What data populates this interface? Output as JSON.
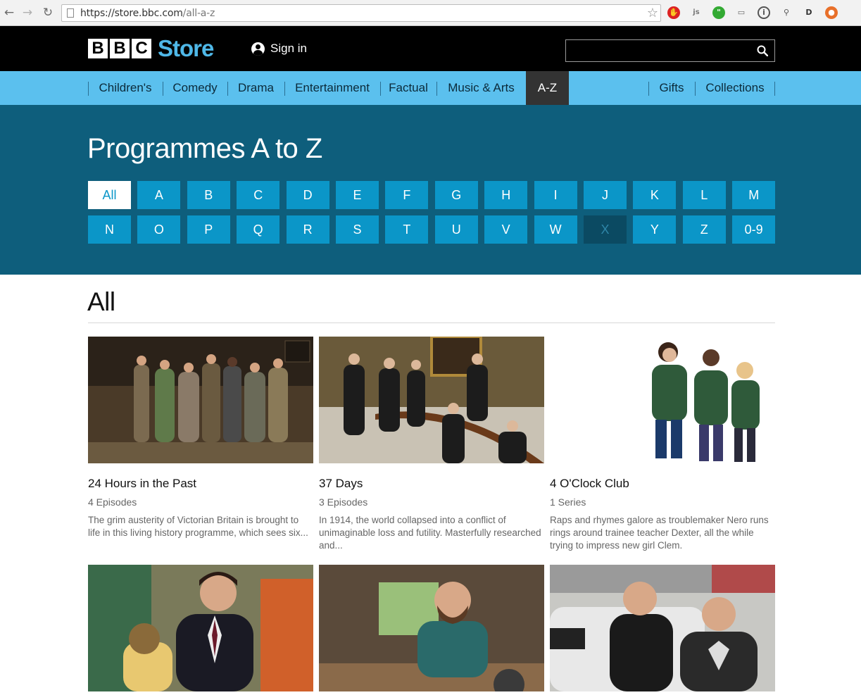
{
  "browser": {
    "url_host": "https://store.bbc.com",
    "url_path": "/all-a-z"
  },
  "header": {
    "logo_letters": [
      "B",
      "B",
      "C"
    ],
    "logo_store": "Store",
    "sign_in": "Sign in",
    "search_placeholder": ""
  },
  "categories": [
    {
      "label": "Children's",
      "active": false
    },
    {
      "label": "Comedy",
      "active": false
    },
    {
      "label": "Drama",
      "active": false
    },
    {
      "label": "Entertainment",
      "active": false
    },
    {
      "label": "Factual",
      "active": false
    },
    {
      "label": "Music & Arts",
      "active": false
    },
    {
      "label": "A-Z",
      "active": true
    }
  ],
  "right_links": [
    "Gifts",
    "Collections"
  ],
  "az": {
    "title": "Programmes A to Z",
    "row1": [
      "All",
      "A",
      "B",
      "C",
      "D",
      "E",
      "F",
      "G",
      "H",
      "I",
      "J",
      "K",
      "L",
      "M"
    ],
    "row2": [
      "N",
      "O",
      "P",
      "Q",
      "R",
      "S",
      "T",
      "U",
      "V",
      "W",
      "X",
      "Y",
      "Z",
      "0-9"
    ],
    "selected": "All",
    "disabled": [
      "X"
    ]
  },
  "results": {
    "title": "All",
    "cards": [
      {
        "title": "24 Hours in the Past",
        "count": "4 Episodes",
        "desc": "The grim austerity of Victorian Britain is brought to life in this living history programme, which sees six..."
      },
      {
        "title": "37 Days",
        "count": "3 Episodes",
        "desc": "In 1914, the world collapsed into a conflict of unimaginable loss and futility. Masterfully researched and..."
      },
      {
        "title": "4 O'Clock Club",
        "count": "1 Series",
        "desc": "Raps and rhymes galore as troublemaker Nero runs rings around trainee teacher Dexter, all the while trying to impress new girl Clem."
      },
      {
        "title": "",
        "count": "",
        "desc": ""
      },
      {
        "title": "",
        "count": "",
        "desc": ""
      },
      {
        "title": "",
        "count": "",
        "desc": ""
      }
    ]
  },
  "colors": {
    "masthead": "#000000",
    "nav": "#5bc0ee",
    "hero": "#0e5e7c",
    "letter": "#0b96c8",
    "store_logo": "#4fb8e8"
  }
}
